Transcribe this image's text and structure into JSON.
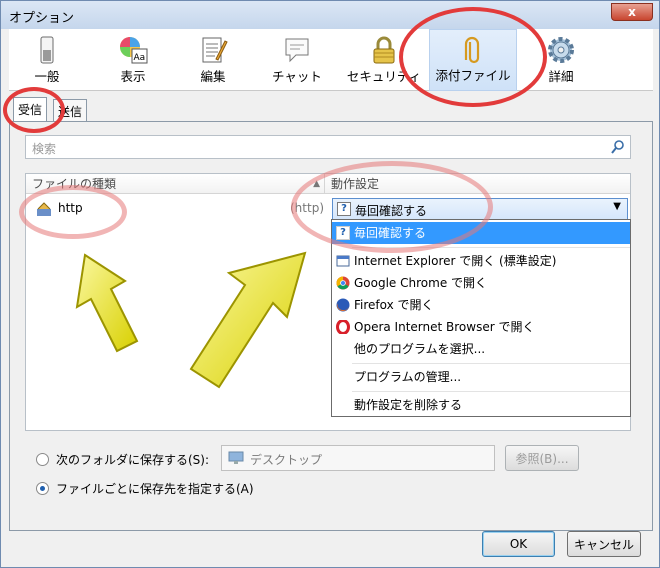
{
  "window": {
    "title": "オプション",
    "close_label": "x"
  },
  "toolbar": {
    "items": [
      {
        "label": "一般",
        "icon": "switch-icon"
      },
      {
        "label": "表示",
        "icon": "palette-icon"
      },
      {
        "label": "編集",
        "icon": "notepad-icon"
      },
      {
        "label": "チャット",
        "icon": "speech-bubble-icon"
      },
      {
        "label": "セキュリティ",
        "icon": "padlock-icon"
      },
      {
        "label": "添付ファイル",
        "icon": "paperclip-icon",
        "selected": true
      },
      {
        "label": "詳細",
        "icon": "gear-icon"
      }
    ]
  },
  "subtabs": {
    "receive": "受信",
    "send": "送信",
    "active": "receive"
  },
  "search": {
    "placeholder": "検索"
  },
  "table": {
    "col_type": "ファイルの種類",
    "col_action": "動作設定",
    "row": {
      "name": "http",
      "type_hint": "(http)",
      "action": "毎回確認する"
    }
  },
  "menu": {
    "items": [
      {
        "label": "毎回確認する",
        "icon": "question-icon",
        "highlighted": true
      },
      {
        "label": "Internet Explorer で開く (標準設定)",
        "icon": "ie-icon"
      },
      {
        "label": "Google Chrome で開く",
        "icon": "chrome-icon"
      },
      {
        "label": "Firefox で開く",
        "icon": "firefox-icon"
      },
      {
        "label": "Opera Internet Browser で開く",
        "icon": "opera-icon"
      },
      {
        "label": "他のプログラムを選択...",
        "icon": ""
      },
      {
        "label": "プログラムの管理...",
        "icon": ""
      },
      {
        "label": "動作設定を削除する",
        "icon": ""
      }
    ]
  },
  "save_options": {
    "folder_label": "次のフォルダに保存する(S):",
    "folder_value": "デスクトップ",
    "browse_label": "参照(B)...",
    "per_file_label": "ファイルごとに保存先を指定する(A)",
    "selected": "per_file"
  },
  "footer": {
    "ok": "OK",
    "cancel": "キャンセル"
  },
  "annotation_colors": {
    "ring": "#e23b3b",
    "arrow": "#e6e000"
  }
}
